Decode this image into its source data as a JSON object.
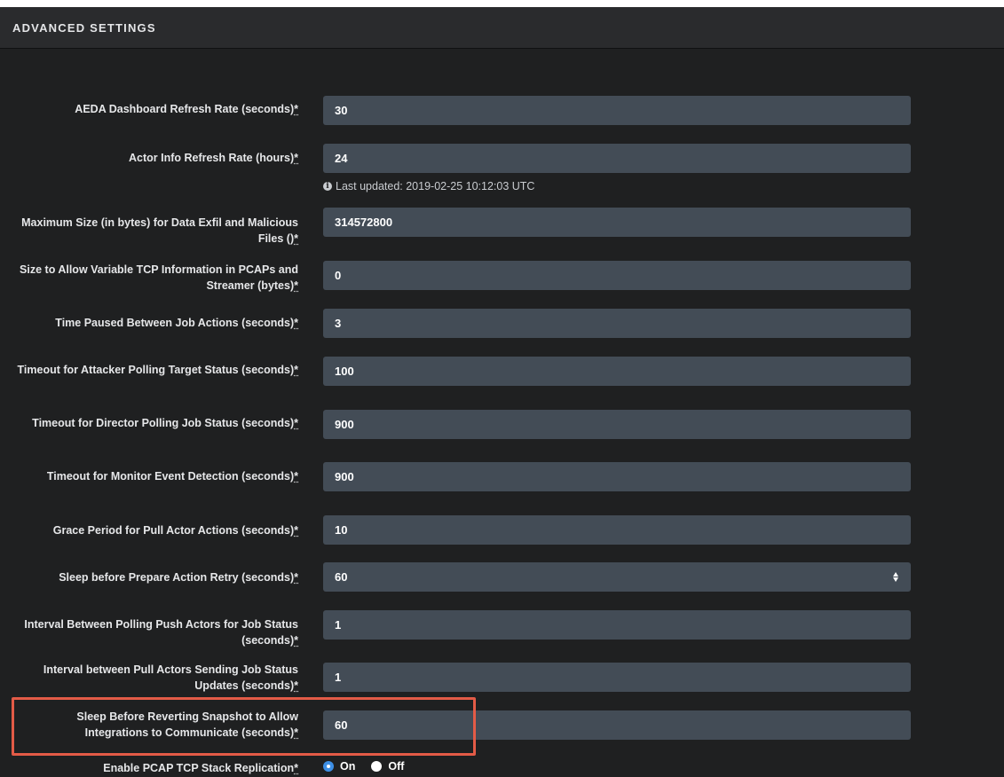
{
  "header": {
    "title": "ADVANCED SETTINGS"
  },
  "required_marker": "*",
  "settings": [
    {
      "label": "AEDA Dashboard Refresh Rate (seconds)",
      "value": "30"
    },
    {
      "label": "Actor Info Refresh Rate (hours)",
      "value": "24"
    },
    {
      "label": "Maximum Size (in bytes) for Data Exfil and Malicious Files ()",
      "value": "314572800"
    },
    {
      "label": "Size to Allow Variable TCP Information in PCAPs and Streamer (bytes)",
      "value": "0"
    },
    {
      "label": "Time Paused Between Job Actions (seconds)",
      "value": "3"
    },
    {
      "label": "Timeout for Attacker Polling Target Status (seconds)",
      "value": "100"
    },
    {
      "label": "Timeout for Director Polling Job Status (seconds)",
      "value": "900"
    },
    {
      "label": "Timeout for Monitor Event Detection (seconds)",
      "value": "900"
    },
    {
      "label": "Grace Period for Pull Actor Actions (seconds)",
      "value": "10"
    },
    {
      "label": "Sleep before Prepare Action Retry (seconds)",
      "value": "60"
    },
    {
      "label": "Interval Between Polling Push Actors for Job Status (seconds)",
      "value": "1"
    },
    {
      "label": "Interval between Pull Actors Sending Job Status Updates (seconds)",
      "value": "1"
    },
    {
      "label": "Sleep Before Reverting Snapshot to Allow Integrations to Communicate (seconds)",
      "value": "60"
    }
  ],
  "actor_info_hint": "Last updated: 2019-02-25 10:12:03 UTC",
  "pcap_replication": {
    "label": "Enable PCAP TCP Stack Replication",
    "options": [
      "On",
      "Off"
    ],
    "selected": "On"
  },
  "colors": {
    "background": "#1f2021",
    "field": "#434c56",
    "highlight": "#e35b47",
    "radio_selected": "#3d8fe6"
  }
}
